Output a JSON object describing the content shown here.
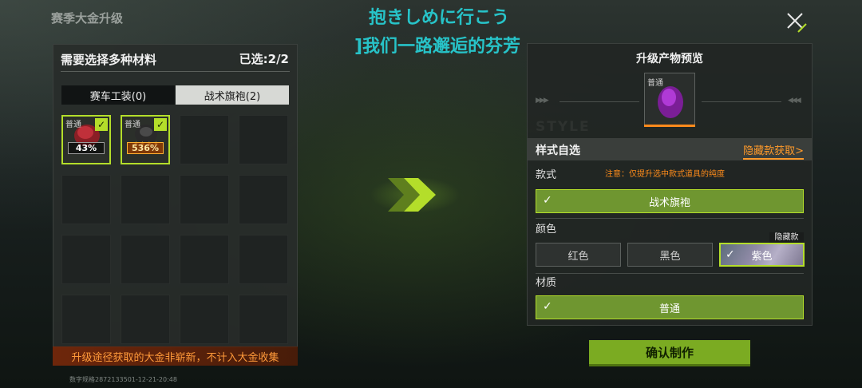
{
  "header": {
    "page_title": "赛季大金升级",
    "overlay_line1": "抱きしめに行こう",
    "overlay_line2": "]我们一路邂逅的芬芳"
  },
  "materials_panel": {
    "title": "需要选择多种材料",
    "selected_count": "已选:2/2",
    "tabs": [
      {
        "label": "赛车工装(0)",
        "active": true
      },
      {
        "label": "战术旗袍(2)",
        "active": false
      }
    ],
    "slots": [
      {
        "rarity": "普通",
        "checked": true,
        "percent": "43%"
      },
      {
        "rarity": "普通",
        "checked": true,
        "percent": "536%"
      }
    ],
    "empty_slot_count": 14,
    "warning": "升级途径获取的大金非崭新，不计入大金收集",
    "footer_id": "数字规格2872133501-12-21-20:48"
  },
  "preview_panel": {
    "title": "升级产物预览",
    "preview_rarity": "普通",
    "style_section": {
      "label": "样式自选",
      "hidden_link": "隐藏款获取>"
    },
    "variant": {
      "label": "款式",
      "note": "注意：仅提升选中款式道具的纯度",
      "selected": "战术旗袍"
    },
    "color": {
      "label": "颜色",
      "hidden_tag": "隐藏款",
      "options": [
        {
          "label": "红色",
          "selected": false
        },
        {
          "label": "黑色",
          "selected": false
        },
        {
          "label": "紫色",
          "selected": true
        }
      ]
    },
    "material": {
      "label": "材质",
      "selected": "普通"
    }
  },
  "confirm_button": "确认制作",
  "colors": {
    "accent_green": "#b4de2a",
    "orange": "#ff9a2a",
    "overlay_text": "#27c3c8"
  },
  "icons": {
    "close": "close-icon",
    "arrow": "double-chevron-right-icon",
    "check": "check-icon"
  }
}
